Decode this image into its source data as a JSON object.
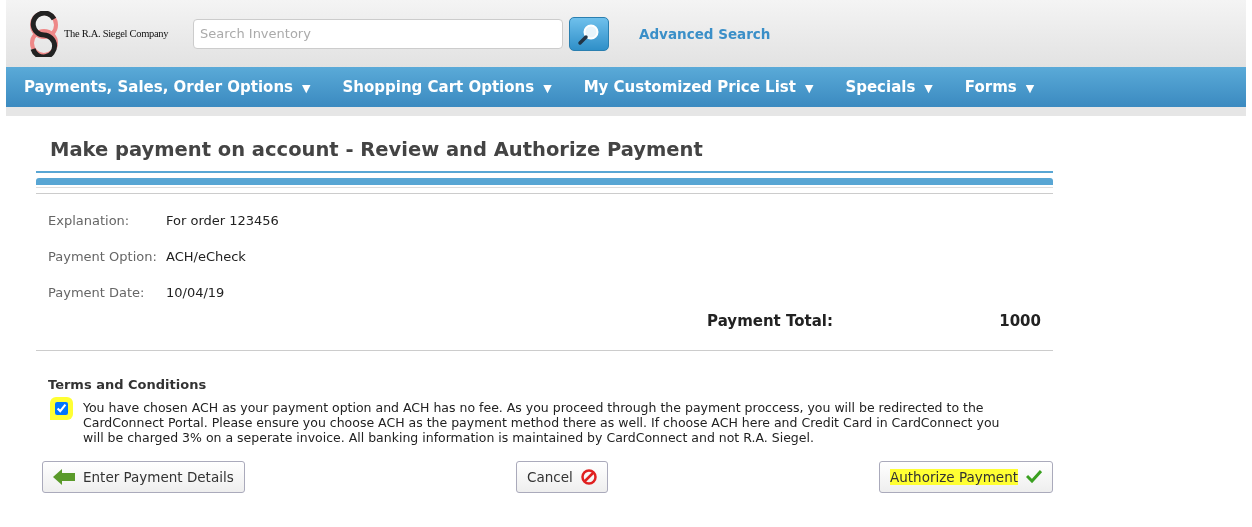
{
  "header": {
    "logo_text": "The R.A. Siegel Company",
    "search": {
      "placeholder": "Search Inventory"
    },
    "advanced_search": "Advanced Search"
  },
  "nav": [
    {
      "label": "Payments, Sales, Order Options",
      "caret": "▼"
    },
    {
      "label": "Shopping Cart Options",
      "caret": "▼"
    },
    {
      "label": "My Customized Price List",
      "caret": "▼"
    },
    {
      "label": "Specials",
      "caret": "▼"
    },
    {
      "label": "Forms",
      "caret": "▼"
    }
  ],
  "page_title": "Make payment on account - Review and Authorize Payment",
  "details": [
    {
      "label": "Explanation:",
      "value": "For order 123456"
    },
    {
      "label": "Payment Option:",
      "value": "ACH/eCheck"
    },
    {
      "label": "Payment Date:",
      "value": "10/04/19"
    }
  ],
  "total": {
    "label": "Payment Total:",
    "value": "1000"
  },
  "terms": {
    "heading": "Terms and Conditions",
    "checked": true,
    "highlighted": true,
    "text": "You have chosen ACH as your payment option and ACH has no fee. As you proceed through the payment proccess, you will be redirected to the CardConnect Portal. Please ensure you choose ACH as the payment method there as well. If choose ACH here and Credit Card in CardConnect you will be charged 3% on a seperate invoice. All banking information is maintained by CardConnect and not R.A. Siegel."
  },
  "buttons": [
    {
      "kind": "back",
      "label": "Enter Payment Details",
      "highlighted": false
    },
    {
      "kind": "cancel",
      "label": "Cancel",
      "highlighted": false
    },
    {
      "kind": "confirm",
      "label": "Authorize Payment",
      "highlighted": true
    }
  ]
}
